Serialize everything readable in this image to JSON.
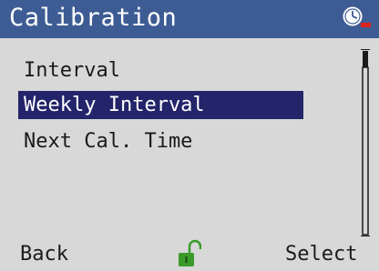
{
  "header": {
    "title": "Calibration",
    "status_icon": "clock-alert-icon"
  },
  "menu": {
    "items": [
      {
        "label": "Interval",
        "selected": false
      },
      {
        "label": "Weekly Interval",
        "selected": true
      },
      {
        "label": "Next Cal. Time",
        "selected": false
      }
    ]
  },
  "footer": {
    "left_label": "Back",
    "center_icon": "unlocked-padlock-icon",
    "right_label": "Select"
  },
  "colors": {
    "header_bg": "#3e5c94",
    "screen_bg": "#d8d8d8",
    "selection_bg": "#24246b",
    "lock_green": "#3a9a2a",
    "alert_red": "#e0201a"
  }
}
